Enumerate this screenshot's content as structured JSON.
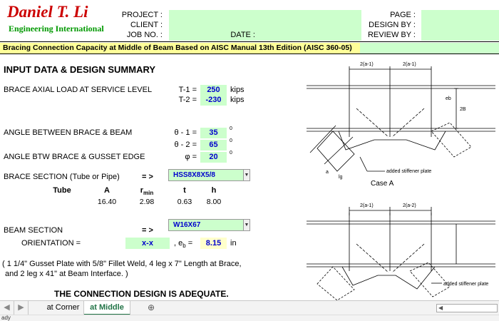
{
  "header": {
    "logo_name": "Daniel T. Li",
    "logo_subtitle": "Engineering International",
    "project_label": "PROJECT :",
    "client_label": "CLIENT :",
    "job_label": "JOB NO. :",
    "date_label": "DATE :",
    "page_label": "PAGE :",
    "design_label": "DESIGN BY :",
    "review_label": "REVIEW BY :"
  },
  "title": "Bracing Connection Capacity at Middle of Beam Based on AISC Manual 13th Edition (AISC 360-05)",
  "section_title": "INPUT DATA & DESIGN SUMMARY",
  "brace_load": {
    "label": "BRACE AXIAL LOAD AT SERVICE LEVEL",
    "t1_label": "T-1 =",
    "t1_value": "250",
    "t2_label": "T-2 =",
    "t2_value": "-230",
    "unit": "kips"
  },
  "angles": {
    "beam_label": "ANGLE BETWEEN BRACE & BEAM",
    "theta1_label": "θ - 1 =",
    "theta1_value": "35",
    "theta2_label": "θ - 2 =",
    "theta2_value": "65",
    "gusset_label": "ANGLE BTW BRACE & GUSSET EDGE",
    "phi_label": "φ =",
    "phi_value": "20",
    "deg": "0"
  },
  "brace_section": {
    "label": "BRACE SECTION (Tube or Pipe)",
    "arrow": "= >",
    "value": "HSS8X8X5/8",
    "props": {
      "headers": [
        "Tube",
        "A",
        "r",
        "t",
        "h"
      ],
      "rmin_sub": "min",
      "values": [
        "16.40",
        "2.98",
        "0.63",
        "8.00"
      ]
    }
  },
  "beam_section": {
    "label": "BEAM SECTION",
    "arrow": "= >",
    "value": "W16X67",
    "orientation_label": "ORIENTATION =",
    "orientation_value": "x-x",
    "eb_prefix": ", e",
    "eb_sub": "b",
    "eb_suffix": " =",
    "eb_value": "8.15",
    "eb_unit": "in"
  },
  "summary": {
    "line1": "( 1 1/4\" Gusset Plate with 5/8\" Fillet Weld, 4 leg x 7\" Length at Brace,",
    "line2": "and 2 leg x 41\" at Beam Interface. )",
    "conclusion": "THE CONNECTION DESIGN IS ADEQUATE."
  },
  "diagram": {
    "top_dim_1": "2(a-1)",
    "top_dim_2": "2(a-1)",
    "stiffener_label": "added stiffener plate",
    "case_label": "Case A",
    "bottom_dim_1": "2(a-1)",
    "bottom_dim_2": "2(a-2)",
    "stiffener_label_2": "added stiffener plate",
    "height_label": "2B",
    "eb_label": "eb",
    "lg_label": "lg",
    "a_label": "a"
  },
  "tabs": {
    "sheets": [
      "at Corner",
      "at Middle"
    ],
    "active_index": 1,
    "add_symbol": "⊕",
    "nav_prev": "◀",
    "nav_next": "▶"
  },
  "status": {
    "text": "ady"
  }
}
